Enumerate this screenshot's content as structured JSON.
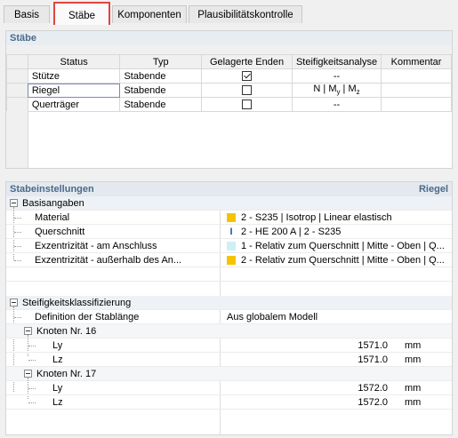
{
  "tabs": [
    {
      "label": "Basis"
    },
    {
      "label": "Stäbe"
    },
    {
      "label": "Komponenten"
    },
    {
      "label": "Plausibilitätskontrolle"
    }
  ],
  "members_section": {
    "title": "Stäbe",
    "columns": [
      "Status",
      "Typ",
      "Gelagerte Enden",
      "Steifigkeitsanalyse",
      "Kommentar"
    ],
    "rows": [
      {
        "status": "Stütze",
        "type": "Stabende",
        "supported_ends": true,
        "stiffness": "--",
        "comment": ""
      },
      {
        "status": "Riegel",
        "type": "Stabende",
        "supported_ends": false,
        "stiffness_parts": [
          "N | M",
          "y",
          " | M",
          "z"
        ],
        "comment": ""
      },
      {
        "status": "Querträger",
        "type": "Stabende",
        "supported_ends": false,
        "stiffness": "--",
        "comment": ""
      }
    ]
  },
  "settings": {
    "title": "Stabeinstellungen",
    "selected_member": "Riegel",
    "basic": {
      "label": "Basisangaben",
      "items": [
        {
          "label": "Material",
          "value": "2 - S235 | Isotrop | Linear elastisch",
          "swatch": "#f5c400"
        },
        {
          "label": "Querschnitt",
          "value": "2 - HE 200 A | 2 - S235",
          "icon": "I"
        },
        {
          "label": "Exzentrizität - am Anschluss",
          "value": "1 - Relativ zum Querschnitt | Mitte - Oben | Q...",
          "swatch": "#cdf0f5"
        },
        {
          "label": "Exzentrizität - außerhalb des An...",
          "value": "2 - Relativ zum Querschnitt | Mitte - Oben | Q...",
          "swatch": "#f5c400"
        }
      ]
    },
    "stiffness": {
      "label": "Steifigkeitsklassifizierung",
      "definition_label": "Definition der Stablänge",
      "definition_value": "Aus globalem Modell",
      "nodes": [
        {
          "label": "Knoten Nr. 16",
          "ly": "1571.0",
          "lz": "1571.0"
        },
        {
          "label": "Knoten Nr. 17",
          "ly": "1572.0",
          "lz": "1572.0"
        }
      ],
      "ly_label": "Ly",
      "lz_label": "Lz",
      "unit": "mm"
    }
  }
}
